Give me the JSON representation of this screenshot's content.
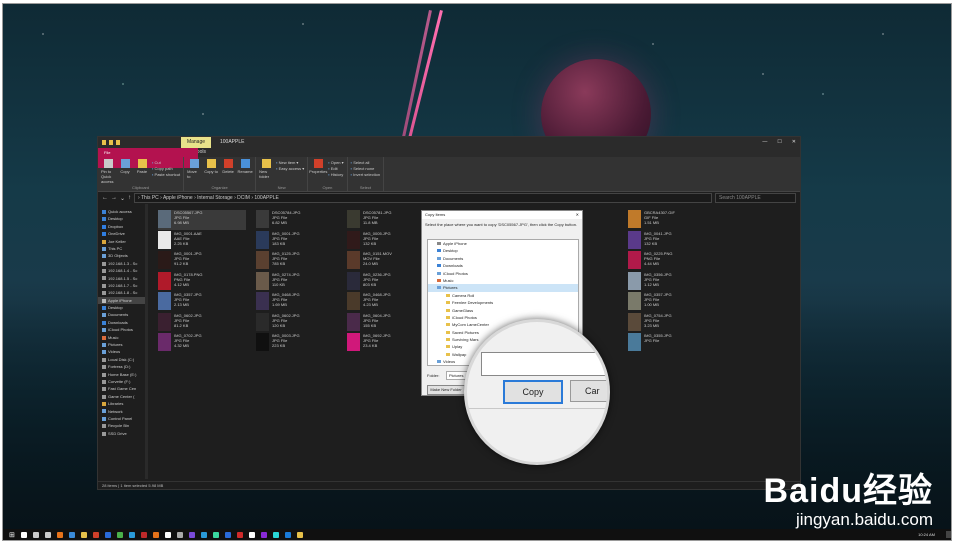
{
  "window": {
    "manage_tab": "Manage",
    "title": "100APPLE",
    "controls": [
      "—",
      "☐",
      "✕"
    ]
  },
  "ribbon_tabs": [
    "File",
    "Home",
    "Share",
    "View",
    "Picture Tools"
  ],
  "ribbon_groups": [
    {
      "label": "Clipboard",
      "buttons": [
        "Pin to Quick access",
        "Copy",
        "Paste"
      ],
      "small": [
        "Cut",
        "Copy path",
        "Paste shortcut"
      ]
    },
    {
      "label": "Organize",
      "buttons": [
        "Move to",
        "Copy to",
        "Delete",
        "Rename"
      ],
      "small": []
    },
    {
      "label": "New",
      "buttons": [
        "New folder"
      ],
      "small": [
        "New item ▾",
        "Easy access ▾"
      ]
    },
    {
      "label": "Open",
      "buttons": [
        "Properties"
      ],
      "small": [
        "Open ▾",
        "Edit",
        "History"
      ]
    },
    {
      "label": "Select",
      "buttons": [],
      "small": [
        "Select all",
        "Select none",
        "Invert selection"
      ]
    }
  ],
  "address": "› This PC › Apple iPhone › Internal Storage › DCIM › 100APPLE",
  "search_placeholder": "Search 100APPLE",
  "nav_items": [
    {
      "label": "Quick access",
      "color": "#3b82d6"
    },
    {
      "label": "Desktop",
      "color": "#3b82d6"
    },
    {
      "label": "Dropbox",
      "color": "#2f7de1"
    },
    {
      "label": "OneDrive",
      "color": "#2f7de1"
    },
    {
      "label": "Joe Keller",
      "color": "#d9a63c"
    },
    {
      "label": "This PC",
      "color": "#6aa0d8"
    },
    {
      "label": "3D Objects",
      "color": "#6aa0d8"
    },
    {
      "label": "192.168.1.3 - Sc",
      "color": "#999999"
    },
    {
      "label": "192.168.1.4 - Sc",
      "color": "#999999"
    },
    {
      "label": "192.168.1.5 - Sc",
      "color": "#999999"
    },
    {
      "label": "192.168.1.7 - Sc",
      "color": "#999999"
    },
    {
      "label": "192.168.1.8 - Sc",
      "color": "#999999"
    },
    {
      "label": "Apple iPhone",
      "color": "#bbbbbb"
    },
    {
      "label": "Desktop",
      "color": "#3b82d6"
    },
    {
      "label": "Documents",
      "color": "#6aa0d8"
    },
    {
      "label": "Downloads",
      "color": "#3b82d6"
    },
    {
      "label": "iCloud Photos",
      "color": "#6aa0d8"
    },
    {
      "label": "Music",
      "color": "#d96b3c"
    },
    {
      "label": "Pictures",
      "color": "#6aa0d8"
    },
    {
      "label": "Videos",
      "color": "#6aa0d8"
    },
    {
      "label": "Local Disk (C:)",
      "color": "#999999"
    },
    {
      "label": "Fortress (D:)",
      "color": "#999999"
    },
    {
      "label": "Home Base (E:)",
      "color": "#999999"
    },
    {
      "label": "Corvette (F:)",
      "color": "#999999"
    },
    {
      "label": "Fast Game Cen",
      "color": "#999999"
    },
    {
      "label": "Game Center (",
      "color": "#999999"
    },
    {
      "label": "Libraries",
      "color": "#d9a63c"
    },
    {
      "label": "Network",
      "color": "#6aa0d8"
    },
    {
      "label": "Control Panel",
      "color": "#6aa0d8"
    },
    {
      "label": "Recycle Bin",
      "color": "#999999"
    },
    {
      "label": "SSD Drive",
      "color": "#999999"
    }
  ],
  "files": [
    {
      "name": "DSC05567.JPG",
      "type": "JPG File",
      "size": "6.98 MB",
      "color": "#5a6a7a"
    },
    {
      "name": "IMG_0001.AAE",
      "type": "AAE File",
      "size": "2.25 KB",
      "color": "#e8e8e8"
    },
    {
      "name": "IMG_0001.JPG",
      "type": "JPG File",
      "size": "91.2 KB",
      "color": "#2a1a18"
    },
    {
      "name": "IMG_0178.PNG",
      "type": "PNG File",
      "size": "4.12 MB",
      "color": "#b01a2a"
    },
    {
      "name": "IMG_0357.JPG",
      "type": "JPG File",
      "size": "2.13 MB",
      "color": "#4a6aa0"
    },
    {
      "name": "IMG_0602.JPG",
      "type": "JPG File",
      "size": "81.2 KB",
      "color": "#3a2030"
    },
    {
      "name": "IMG_0702.JPG",
      "type": "JPG File",
      "size": "4.32 MB",
      "color": "#6a2a6a"
    },
    {
      "name": "DSC05784.JPG",
      "type": "JPG File",
      "size": "6.82 MB",
      "color": "#3a3a3a"
    },
    {
      "name": "IMG_0001.JPG",
      "type": "JPG File",
      "size": "183 KB",
      "color": "#2a3a5a"
    },
    {
      "name": "IMG_0125.JPG",
      "type": "JPG File",
      "size": "785 KB",
      "color": "#5a4030"
    },
    {
      "name": "IMG_0274.JPG",
      "type": "JPG File",
      "size": "110 KB",
      "color": "#6a5a4a"
    },
    {
      "name": "IMG_0468.JPG",
      "type": "JPG File",
      "size": "1.69 MB",
      "color": "#3a3050"
    },
    {
      "name": "IMG_0602.JPG",
      "type": "JPG File",
      "size": "120 KB",
      "color": "#2a2a2a"
    },
    {
      "name": "IMG_0003.JPG",
      "type": "JPG File",
      "size": "223 KB",
      "color": "#101010"
    },
    {
      "name": "DSC05781.JPG",
      "type": "JPG File",
      "size": "11.8 MB",
      "color": "#3a3a30"
    },
    {
      "name": "IMG_0005.JPG",
      "type": "JPG File",
      "size": "132 KB",
      "color": "#301a1a"
    },
    {
      "name": "IMG_0151.MOV",
      "type": "MOV File",
      "size": "24.0 MB",
      "color": "#5a3a2a"
    },
    {
      "name": "IMG_0236.JPG",
      "type": "JPG File",
      "size": "803 KB",
      "color": "#2a2a3a"
    },
    {
      "name": "IMG_0468.JPG",
      "type": "JPG File",
      "size": "4.23 MB",
      "color": "#4a3a2a"
    },
    {
      "name": "IMG_0604.JPG",
      "type": "JPG File",
      "size": "155 KB",
      "color": "#4a2a4a"
    },
    {
      "name": "IMG_0692.JPG",
      "type": "JPG File",
      "size": "23.4 KB",
      "color": "#d0187a"
    },
    {
      "name": "GBCRA4307.GIF",
      "type": "GIF File",
      "size": "1.51 MB",
      "color": "#c07a2a"
    },
    {
      "name": "IMG_0041.JPG",
      "type": "JPG File",
      "size": "132 KB",
      "color": "#5a3a8a"
    },
    {
      "name": "IMG_0225.PNG",
      "type": "PNG File",
      "size": "4.44 MB",
      "color": "#b01a4a"
    },
    {
      "name": "IMG_0356.JPG",
      "type": "JPG File",
      "size": "1.12 MB",
      "color": "#8a9aaa"
    },
    {
      "name": "IMG_0357.JPG",
      "type": "JPG File",
      "size": "1.00 MB",
      "color": "#7a7a6a"
    },
    {
      "name": "IMG_0754.JPG",
      "type": "JPG File",
      "size": "3.23 MB",
      "color": "#5a4a3a"
    },
    {
      "name": "IMG_0355.JPG",
      "type": "JPG File",
      "size": "",
      "color": "#4a7a9a"
    }
  ],
  "status": "28 items  |  1 item selected  5.98 MB",
  "dialog": {
    "title": "Copy Items",
    "close": "✕",
    "description": "Select the place where you want to copy 'DSC05567.JPG', then click the Copy button.",
    "tree": [
      {
        "label": "Apple iPhone",
        "indent": 1,
        "color": "#888888"
      },
      {
        "label": "Desktop",
        "indent": 1,
        "color": "#3b82d6"
      },
      {
        "label": "Documents",
        "indent": 1,
        "color": "#6aa0d8"
      },
      {
        "label": "Downloads",
        "indent": 1,
        "color": "#3b82d6"
      },
      {
        "label": "iCloud Photos",
        "indent": 1,
        "color": "#6aa0d8"
      },
      {
        "label": "Music",
        "indent": 1,
        "color": "#d96b3c"
      },
      {
        "label": "Pictures",
        "indent": 1,
        "color": "#6aa0d8"
      },
      {
        "label": "Camera Roll",
        "indent": 2,
        "color": "#e8c14a"
      },
      {
        "label": "Feenlee Developments",
        "indent": 2,
        "color": "#e8c14a"
      },
      {
        "label": "GameGlass",
        "indent": 2,
        "color": "#e8c14a"
      },
      {
        "label": "iCloud Photos",
        "indent": 2,
        "color": "#e8c14a"
      },
      {
        "label": "MyCom LameCenter",
        "indent": 2,
        "color": "#e8c14a"
      },
      {
        "label": "Saved Pictures",
        "indent": 2,
        "color": "#e8c14a"
      },
      {
        "label": "Surviving Mars",
        "indent": 2,
        "color": "#e8c14a"
      },
      {
        "label": "Uplay",
        "indent": 2,
        "color": "#e8c14a"
      },
      {
        "label": "Wallpap",
        "indent": 2,
        "color": "#e8c14a"
      },
      {
        "label": "Videos",
        "indent": 1,
        "color": "#6aa0d8"
      }
    ],
    "folder_label": "Folder:",
    "folder_value": "Pictures",
    "new_folder": "Make New Folder",
    "copy": "Copy",
    "cancel": "Car"
  },
  "taskbar": {
    "time": "10:24 AM",
    "icons": [
      "#ffffff",
      "#cccccc",
      "#cccccc",
      "#e8731a",
      "#3a8ad8",
      "#e8c14a",
      "#d0402a",
      "#2a6ad8",
      "#4ab04a",
      "#2a9ad8",
      "#c02a2a",
      "#e8731a",
      "#ffffff",
      "#aaaaaa",
      "#7a4ad8",
      "#2a9ad8",
      "#3ad8a0",
      "#2a6ad8",
      "#d02a2a",
      "#ffffff",
      "#8a2ad8",
      "#2ad8d8",
      "#1a7ad8",
      "#e8c14a"
    ]
  },
  "watermark": {
    "brand": "Baidu经验",
    "site": "jingyan.baidu.com"
  }
}
